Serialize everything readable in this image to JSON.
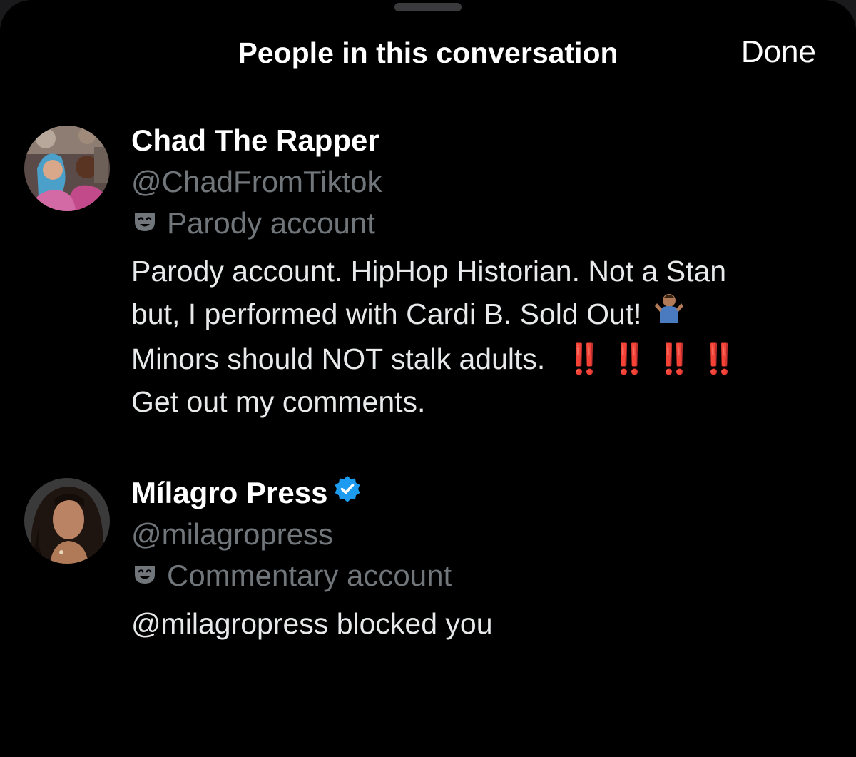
{
  "header": {
    "title": "People in this conversation",
    "done_label": "Done"
  },
  "people": [
    {
      "name": "Chad The Rapper",
      "handle": "@ChadFromTiktok",
      "account_label": "Parody account",
      "account_label_icon": "theater-mask-icon",
      "verified": false,
      "bio_lines": [
        "Parody account. HipHop Historian. Not a Stan",
        "but, I performed with Cardi B. Sold Out!",
        "Minors should NOT stalk adults.",
        "Get out my comments."
      ],
      "bio_emoji": {
        "shrug": "🤷🏽‍♂️",
        "double_exclamation": "‼️",
        "double_exclamation_count": 4
      }
    },
    {
      "name": "Mílagro Press",
      "handle": "@milagropress",
      "account_label": "Commentary account",
      "account_label_icon": "theater-mask-icon",
      "verified": true,
      "verified_color": "#1d9bf0",
      "status_text": "@milagropress blocked you"
    }
  ],
  "colors": {
    "background": "#000000",
    "primary_text": "#e7e9ea",
    "secondary_text": "#71767b",
    "alert_red": "#e0301e",
    "verified_blue": "#1d9bf0"
  }
}
